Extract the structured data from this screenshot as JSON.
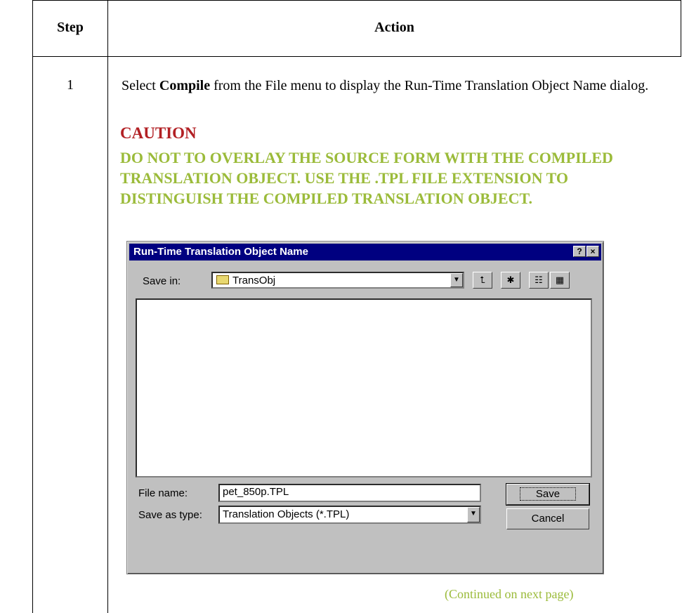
{
  "table": {
    "header_step": "Step",
    "header_action": "Action",
    "step_number": "1",
    "instruction_pre": "Select ",
    "instruction_bold": "Compile",
    "instruction_post": " from the File menu to display the Run-Time Translation Object Name dialog.",
    "caution_title": "CAUTION",
    "caution_text": "DO NOT TO OVERLAY THE SOURCE FORM WITH THE COMPILED TRANSLATION OBJECT. USE THE .TPL FILE EXTENSION TO DISTINGUISH THE COMPILED TRANSLATION OBJECT.",
    "continued": "(Continued on next page)"
  },
  "dialog": {
    "title": "Run-Time Translation Object Name",
    "help_button": "?",
    "close_button": "×",
    "save_in_label": "Save in:",
    "save_in_value": "TransObj",
    "file_name_label": "File name:",
    "file_name_value": "pet_850p.TPL",
    "save_as_type_label": "Save as type:",
    "save_as_type_value": "Translation Objects (*.TPL)",
    "save_button": "Save",
    "cancel_button": "Cancel"
  },
  "colors": {
    "caution_title": "#b22024",
    "caution_text": "#9bbb3a",
    "titlebar": "#000080",
    "dialog_face": "#c0c0c0"
  }
}
